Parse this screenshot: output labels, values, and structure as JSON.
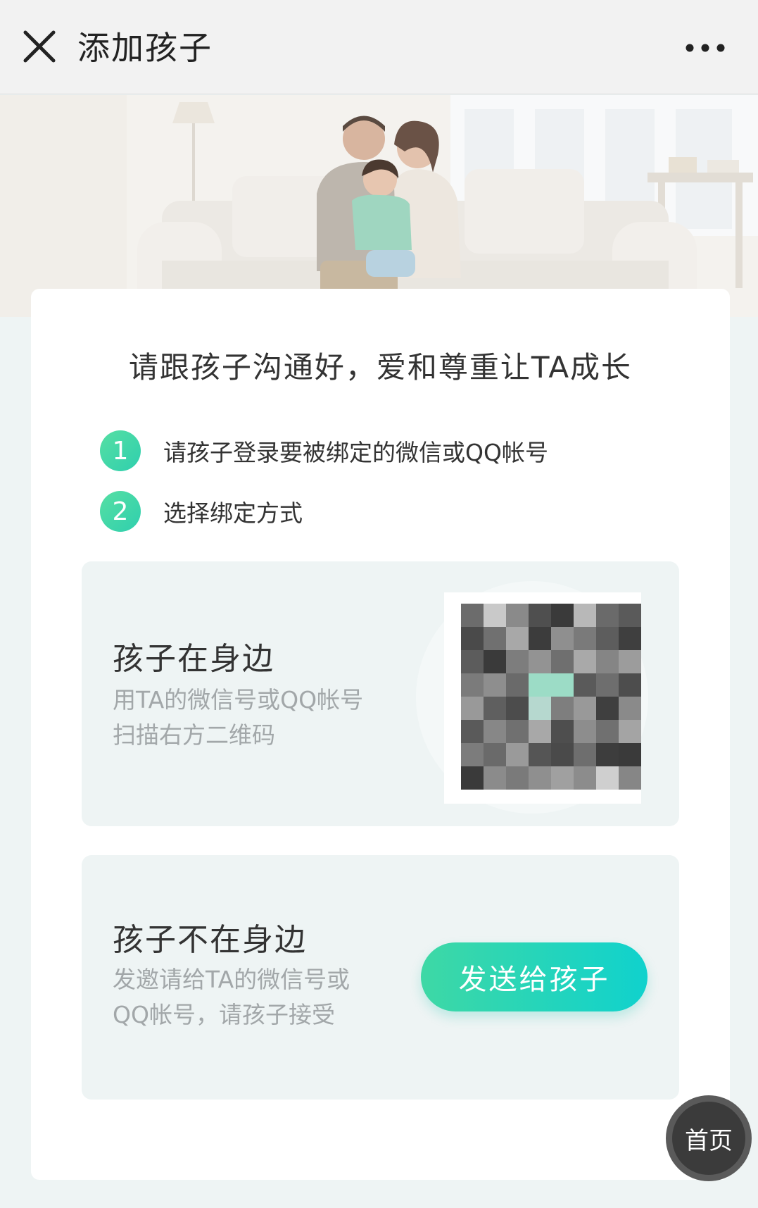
{
  "header": {
    "title": "添加孩子",
    "close_icon": "close-icon",
    "more_icon": "more-icon"
  },
  "banner": {
    "image": "family-on-sofa-photo"
  },
  "card": {
    "heading": "请跟孩子沟通好，爱和尊重让TA成长",
    "steps": [
      {
        "number": "1",
        "text": "请孩子登录要被绑定的微信或QQ帐号"
      },
      {
        "number": "2",
        "text": "选择绑定方式"
      }
    ],
    "options": {
      "near": {
        "title": "孩子在身边",
        "desc_line1": "用TA的微信号或QQ帐号",
        "desc_line2": "扫描右方二维码"
      },
      "far": {
        "title": "孩子不在身边",
        "desc_line1": "发邀请给TA的微信号或",
        "desc_line2": "QQ帐号，请孩子接受",
        "button_label": "发送给孩子"
      }
    }
  },
  "home_button": {
    "label": "首页"
  },
  "colors": {
    "accent_start": "#3ed8a5",
    "accent_end": "#10d2cd",
    "option_bg": "#eef4f4",
    "secondary_text": "#a2a7a9"
  }
}
